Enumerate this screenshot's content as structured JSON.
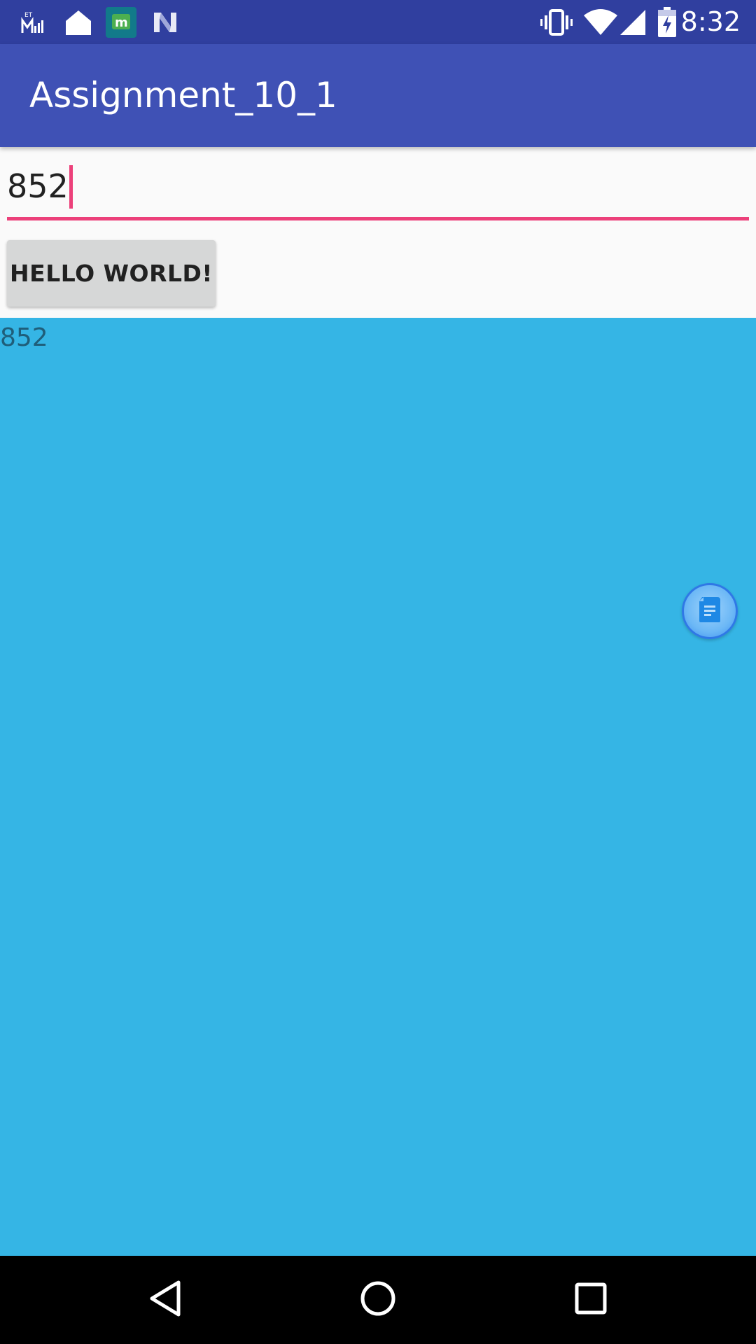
{
  "status_bar": {
    "time": "8:32",
    "left_icons": [
      "et-money-icon",
      "home-icon",
      "m-app-icon",
      "n-app-icon"
    ],
    "right_icons": [
      "vibrate-icon",
      "wifi-icon",
      "signal-icon",
      "battery-charging-icon"
    ],
    "background": "#303f9f"
  },
  "app_bar": {
    "title": "Assignment_10_1",
    "background": "#3f51b5"
  },
  "edit_text": {
    "value": "852",
    "accent_color": "#ec407a"
  },
  "button": {
    "label": "HELLO WORLD!"
  },
  "content": {
    "result_text": "852",
    "background": "#35b5e5"
  },
  "floating_bubble": {
    "icon": "document-icon"
  },
  "nav_bar": {
    "buttons": [
      "back-icon",
      "home-circle-icon",
      "recents-icon"
    ]
  }
}
